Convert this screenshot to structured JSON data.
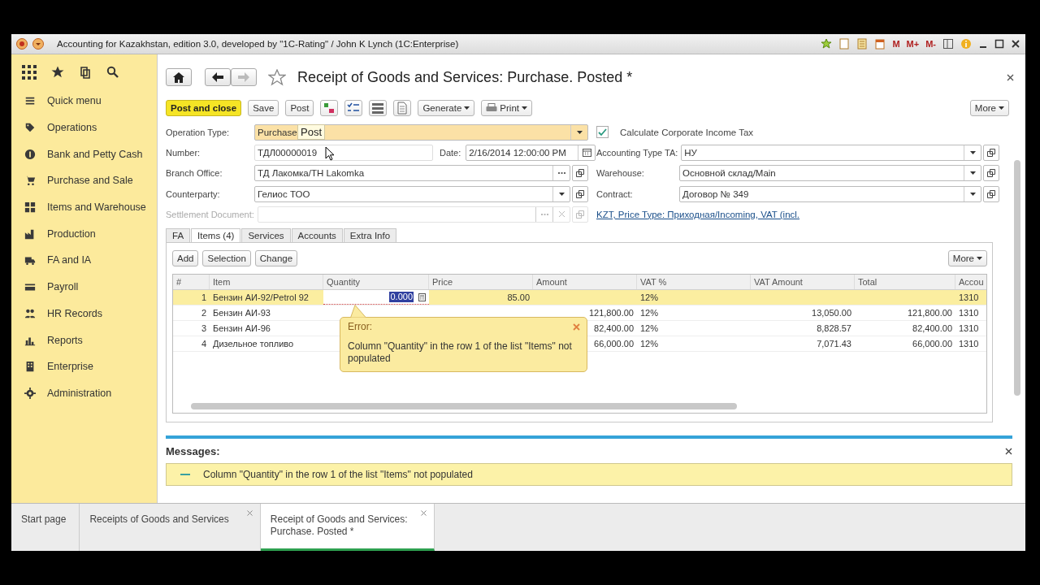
{
  "window": {
    "title": "Accounting for Kazakhstan, edition 3.0, developed by \"1C-Rating\" / John K Lynch  (1C:Enterprise)",
    "memory_buttons": [
      "M",
      "M+",
      "M-"
    ]
  },
  "sidebar": {
    "items": [
      "Quick menu",
      "Operations",
      "Bank and Petty Cash",
      "Purchase and Sale",
      "Items and Warehouse",
      "Production",
      "FA and IA",
      "Payroll",
      "HR Records",
      "Reports",
      "Enterprise",
      "Administration"
    ]
  },
  "document": {
    "title": "Receipt of Goods and Services: Purchase. Posted *"
  },
  "toolbar": {
    "buttons": [
      {
        "label": "Post and close",
        "kind": "primary"
      },
      {
        "label": "Save",
        "kind": "plain"
      },
      {
        "label": "Post",
        "kind": "plain"
      },
      {
        "label": "Generate",
        "kind": "menu"
      },
      {
        "label": "Print",
        "kind": "print"
      }
    ],
    "more": "More"
  },
  "tooltip": "Post",
  "form": {
    "operation_type": {
      "label": "Operation Type:",
      "value": "Purchase"
    },
    "number": {
      "label": "Number:",
      "value": "ТДЛ00000019"
    },
    "date": {
      "label": "Date:",
      "value": "2/16/2014 12:00:00 PM"
    },
    "branch_office": {
      "label": "Branch Office:",
      "value": "ТД Лакомка/ТН Lakomka"
    },
    "counterparty": {
      "label": "Counterparty:",
      "value": "Гелиос ТОО"
    },
    "settlement_document": {
      "label": "Settlement Document:",
      "disabled": true
    },
    "corporate_income_tax": {
      "label": "Calculate Corporate Income Tax",
      "checked": true
    },
    "accounting_type": {
      "label": "Accounting Type TA:",
      "value": "НУ"
    },
    "warehouse": {
      "label": "Warehouse:",
      "value": "Основной склад/Main"
    },
    "contract": {
      "label": "Contract:",
      "value": "Договор № 349"
    },
    "price_link": "KZT, Price Type: Приходная/Incoming, VAT (incl."
  },
  "tabs": [
    {
      "label": "FA",
      "selected": false
    },
    {
      "label": "Items (4)",
      "selected": true
    },
    {
      "label": "Services",
      "selected": false
    },
    {
      "label": "Accounts",
      "selected": false
    },
    {
      "label": "Extra Info",
      "selected": false
    }
  ],
  "table_buttons": [
    "Add",
    "Selection",
    "Change"
  ],
  "table_more": "More",
  "table": {
    "columns": [
      "#",
      "Item",
      "Quantity",
      "Price",
      "Amount",
      "VAT %",
      "VAT Amount",
      "Total",
      "Accou"
    ],
    "rows": [
      {
        "number": "1",
        "item": "Бензин АИ-92/Petrol 92",
        "quantity": "0.000",
        "quantity_editing": true,
        "price": "85.00",
        "vat_rate": "12%",
        "account": "1310",
        "selected": true
      },
      {
        "number": "2",
        "item": "Бензин АИ-93",
        "amount": "121,800.00",
        "vat_rate": "12%",
        "vat_amount": "13,050.00",
        "total": "121,800.00",
        "account": "1310",
        "selected": false
      },
      {
        "number": "3",
        "item": "Бензин АИ-96",
        "amount": "82,400.00",
        "vat_rate": "12%",
        "vat_amount": "8,828.57",
        "total": "82,400.00",
        "account": "1310",
        "selected": false
      },
      {
        "number": "4",
        "item": "Дизельное топливо",
        "amount": "66,000.00",
        "vat_rate": "12%",
        "vat_amount": "7,071.43",
        "total": "66,000.00",
        "account": "1310",
        "selected": false
      }
    ]
  },
  "error_popup": {
    "title": "Error:",
    "text": "Column \"Quantity\" in the row 1 of the list \"Items\" not populated"
  },
  "messages": {
    "title": "Messages:",
    "items": [
      "Column \"Quantity\" in the row 1 of the list \"Items\" not populated"
    ]
  },
  "open_tabs": [
    {
      "label": "Start page",
      "closable": false,
      "selected": false
    },
    {
      "label": "Receipts of Goods and Services",
      "closable": true,
      "selected": false
    },
    {
      "label": "Receipt of Goods and Services: Purchase. Posted *",
      "closable": true,
      "selected": true
    }
  ]
}
